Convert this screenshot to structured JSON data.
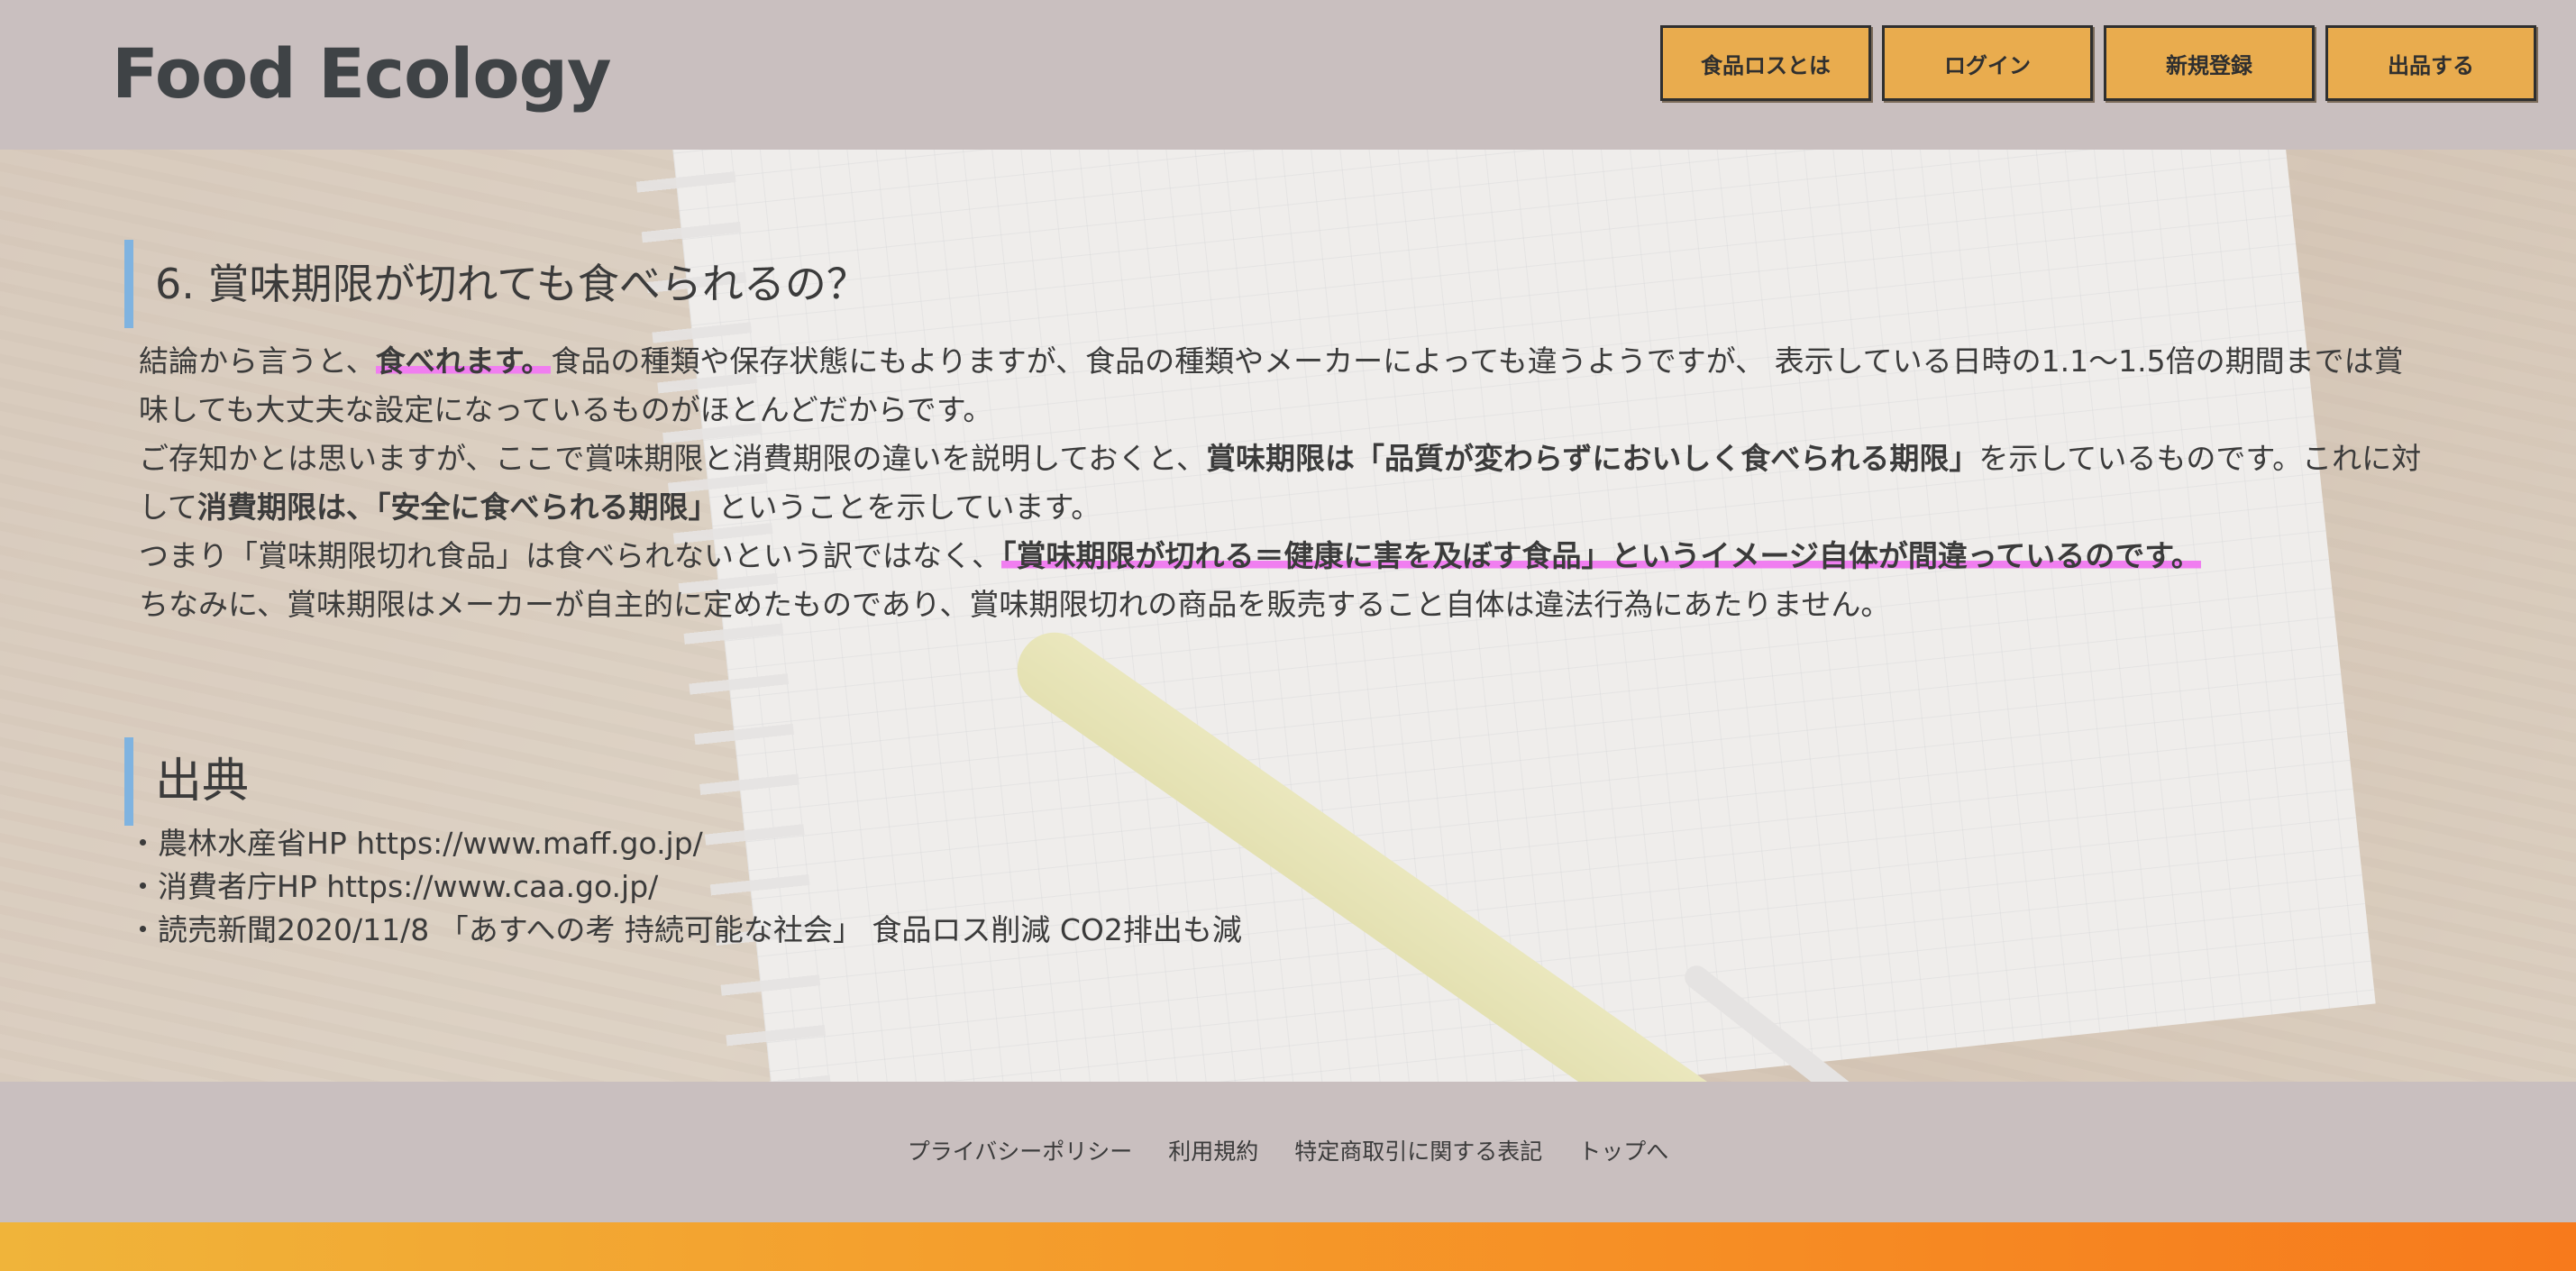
{
  "header": {
    "logo": "Food Ecology",
    "nav": [
      "食品ロスとは",
      "ログイン",
      "新規登録",
      "出品する"
    ]
  },
  "section6": {
    "heading": "6. 賞味期限が切れても食べられるの？",
    "p1_a": "結論から言うと、",
    "p1_hl": "食べれます。",
    "p1_b": "食品の種類や保存状態にもよりますが、食品の種類やメーカーによっても違うようですが、 表示している日時の1.1〜1.5倍の期間までは賞味しても大丈夫な設定になっているものがほとんどだからです。",
    "p2_a": "ご存知かとは思いますが、ここで賞味期限と消費期限の違いを説明しておくと、",
    "p2_b1": "賞味期限は「品質が変わらずにおいしく食べられる期限」",
    "p2_c": "を示しているものです。これに対して",
    "p2_b2": "消費期限は、「安全に食べられる期限」",
    "p2_d": "ということを示しています。",
    "p3_a": "つまり「賞味期限切れ食品」は食べられないという訳ではなく、",
    "p3_hl": "「賞味期限が切れる＝健康に害を及ぼす食品」というイメージ自体が間違っているのです。",
    "p4": "ちなみに、賞味期限はメーカーが自主的に定めたものであり、賞味期限切れの商品を販売すること自体は違法行為にあたりません。"
  },
  "sources": {
    "heading": "出典",
    "items": [
      "・農林水産省HP https://www.maff.go.jp/",
      "・消費者庁HP https://www.caa.go.jp/",
      "・読売新聞2020/11/8 「あすへの考 持続可能な社会」 食品ロス削減 CO2排出も減"
    ]
  },
  "footer": {
    "links": [
      "プライバシーポリシー",
      "利用規約",
      "特定商取引に関する表記",
      "トップへ"
    ]
  },
  "colors": {
    "header_bg": "#c9bfbf",
    "nav_button": "#e9ac4e",
    "heading_accent": "#7fb3e0",
    "highlight": "#f07ef0",
    "bottom_bar_start": "#f0b43a",
    "bottom_bar_end": "#f77a1c"
  }
}
